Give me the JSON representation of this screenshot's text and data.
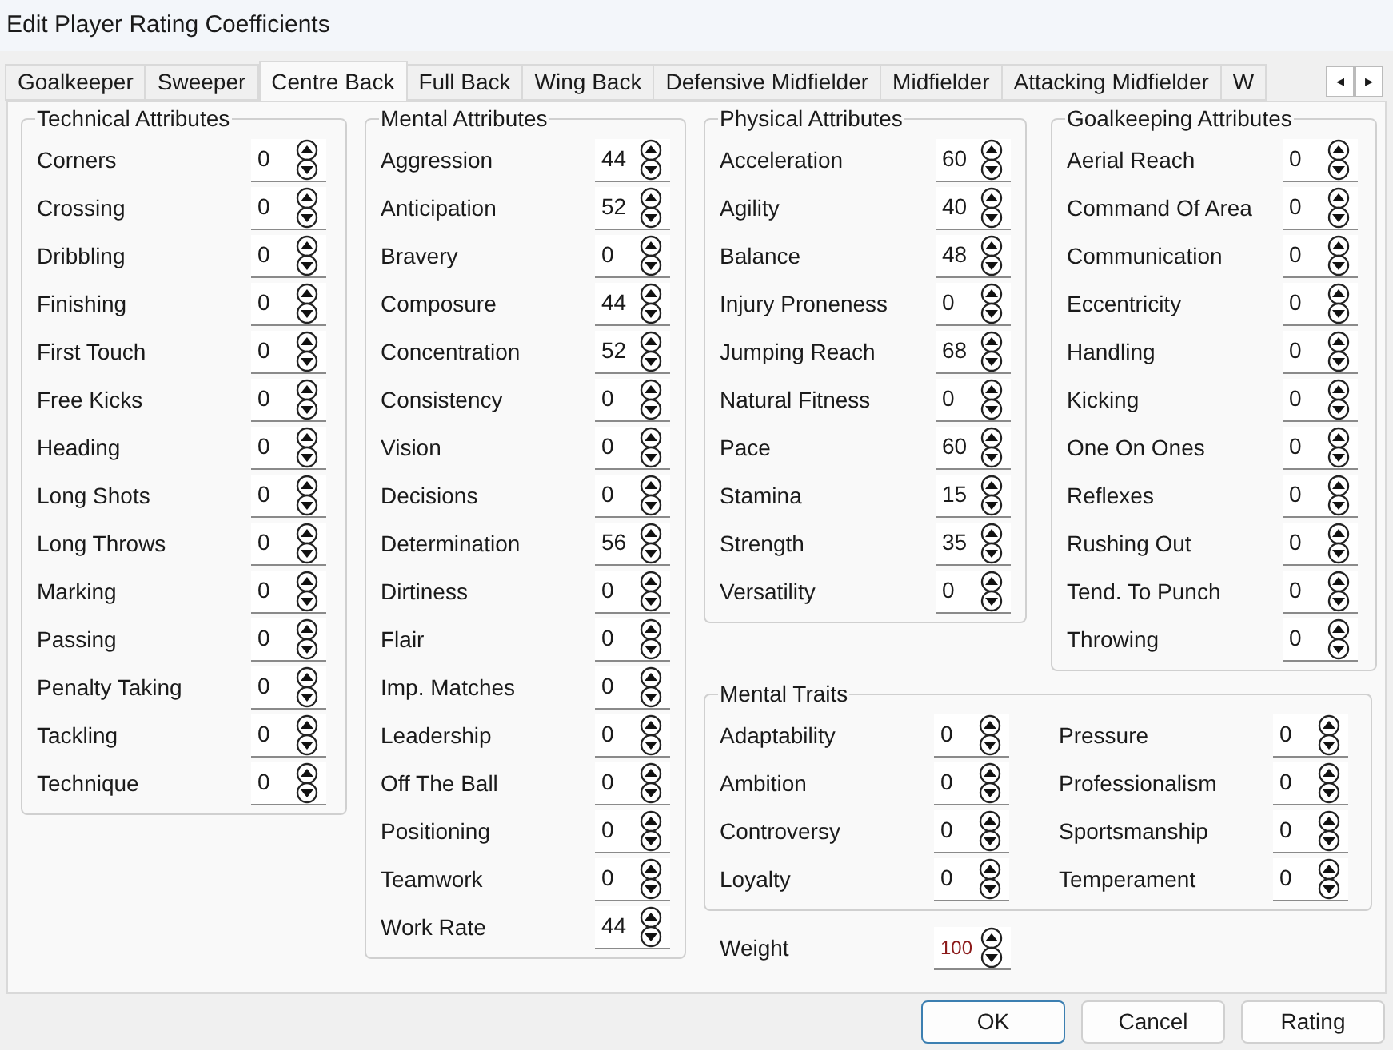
{
  "window": {
    "title": "Edit Player Rating Coefficients"
  },
  "tabs": [
    {
      "label": "Goalkeeper",
      "selected": false
    },
    {
      "label": "Sweeper",
      "selected": false
    },
    {
      "label": "Centre Back",
      "selected": true
    },
    {
      "label": "Full Back",
      "selected": false
    },
    {
      "label": "Wing Back",
      "selected": false
    },
    {
      "label": "Defensive Midfielder",
      "selected": false
    },
    {
      "label": "Midfielder",
      "selected": false
    },
    {
      "label": "Attacking Midfielder",
      "selected": false
    },
    {
      "label": "W",
      "selected": false
    }
  ],
  "tab_scroll": {
    "left": "◂",
    "right": "▸"
  },
  "groups": [
    {
      "title": "Technical Attributes",
      "items": [
        {
          "label": "Corners",
          "value": "0"
        },
        {
          "label": "Crossing",
          "value": "0"
        },
        {
          "label": "Dribbling",
          "value": "0"
        },
        {
          "label": "Finishing",
          "value": "0"
        },
        {
          "label": "First Touch",
          "value": "0"
        },
        {
          "label": "Free Kicks",
          "value": "0"
        },
        {
          "label": "Heading",
          "value": "0"
        },
        {
          "label": "Long Shots",
          "value": "0"
        },
        {
          "label": "Long Throws",
          "value": "0"
        },
        {
          "label": "Marking",
          "value": "0"
        },
        {
          "label": "Passing",
          "value": "0"
        },
        {
          "label": "Penalty Taking",
          "value": "0"
        },
        {
          "label": "Tackling",
          "value": "0"
        },
        {
          "label": "Technique",
          "value": "0"
        }
      ]
    },
    {
      "title": "Mental Attributes",
      "items": [
        {
          "label": "Aggression",
          "value": "44"
        },
        {
          "label": "Anticipation",
          "value": "52"
        },
        {
          "label": "Bravery",
          "value": "0"
        },
        {
          "label": "Composure",
          "value": "44"
        },
        {
          "label": "Concentration",
          "value": "52"
        },
        {
          "label": "Consistency",
          "value": "0"
        },
        {
          "label": "Vision",
          "value": "0"
        },
        {
          "label": "Decisions",
          "value": "0"
        },
        {
          "label": "Determination",
          "value": "56"
        },
        {
          "label": "Dirtiness",
          "value": "0"
        },
        {
          "label": "Flair",
          "value": "0"
        },
        {
          "label": "Imp. Matches",
          "value": "0"
        },
        {
          "label": "Leadership",
          "value": "0"
        },
        {
          "label": "Off The Ball",
          "value": "0"
        },
        {
          "label": "Positioning",
          "value": "0"
        },
        {
          "label": "Teamwork",
          "value": "0"
        },
        {
          "label": "Work Rate",
          "value": "44"
        }
      ]
    },
    {
      "title": "Physical Attributes",
      "items": [
        {
          "label": "Acceleration",
          "value": "60"
        },
        {
          "label": "Agility",
          "value": "40"
        },
        {
          "label": "Balance",
          "value": "48"
        },
        {
          "label": "Injury Proneness",
          "value": "0"
        },
        {
          "label": "Jumping Reach",
          "value": "68"
        },
        {
          "label": "Natural Fitness",
          "value": "0"
        },
        {
          "label": "Pace",
          "value": "60"
        },
        {
          "label": "Stamina",
          "value": "15"
        },
        {
          "label": "Strength",
          "value": "35"
        },
        {
          "label": "Versatility",
          "value": "0"
        }
      ]
    },
    {
      "title": "Goalkeeping Attributes",
      "items": [
        {
          "label": "Aerial Reach",
          "value": "0"
        },
        {
          "label": "Command Of Area",
          "value": "0"
        },
        {
          "label": "Communication",
          "value": "0"
        },
        {
          "label": "Eccentricity",
          "value": "0"
        },
        {
          "label": "Handling",
          "value": "0"
        },
        {
          "label": "Kicking",
          "value": "0"
        },
        {
          "label": "One On Ones",
          "value": "0"
        },
        {
          "label": "Reflexes",
          "value": "0"
        },
        {
          "label": "Rushing Out",
          "value": "0"
        },
        {
          "label": "Tend. To Punch",
          "value": "0"
        },
        {
          "label": "Throwing",
          "value": "0"
        }
      ]
    },
    {
      "title": "Mental Traits",
      "items": [
        {
          "label": "Adaptability",
          "value": "0"
        },
        {
          "label": "Pressure",
          "value": "0"
        },
        {
          "label": "Ambition",
          "value": "0"
        },
        {
          "label": "Professionalism",
          "value": "0"
        },
        {
          "label": "Controversy",
          "value": "0"
        },
        {
          "label": "Sportsmanship",
          "value": "0"
        },
        {
          "label": "Loyalty",
          "value": "0"
        },
        {
          "label": "Temperament",
          "value": "0"
        }
      ]
    }
  ],
  "weight": {
    "label": "Weight",
    "value": "100"
  },
  "buttons": [
    {
      "label": "OK",
      "default": true
    },
    {
      "label": "Cancel",
      "default": false
    },
    {
      "label": "Rating",
      "default": false
    }
  ]
}
